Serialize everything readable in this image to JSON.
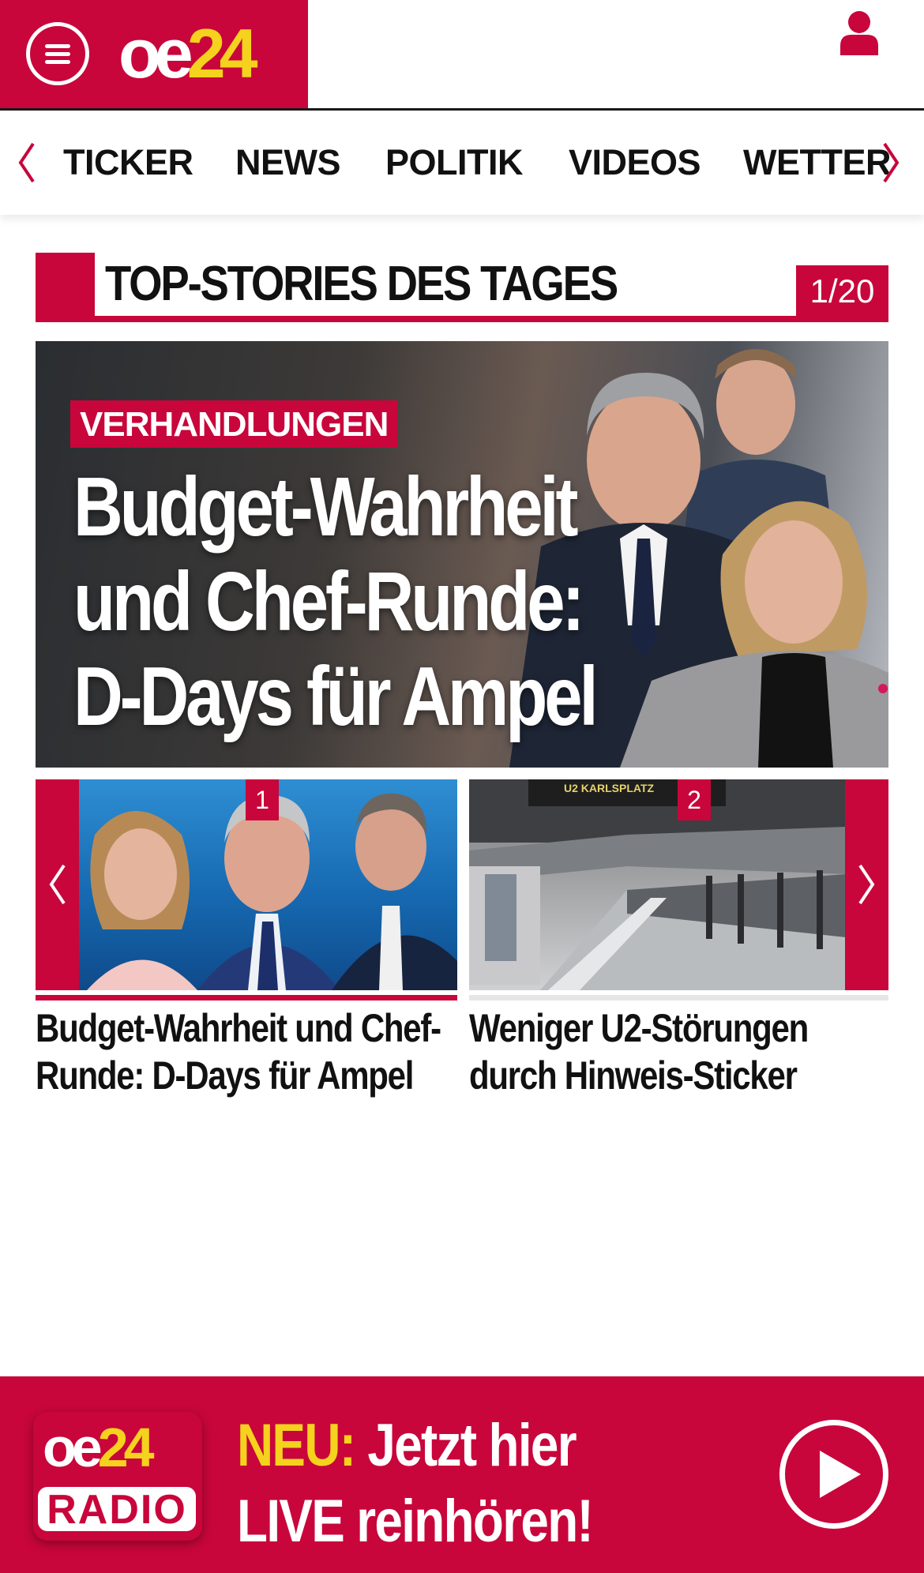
{
  "header": {
    "logo_oe": "oe",
    "logo_num": "24"
  },
  "nav": {
    "items": [
      "TICKER",
      "NEWS",
      "POLITIK",
      "VIDEOS",
      "WETTER"
    ]
  },
  "section": {
    "title": "TOP-STORIES DES TAGES",
    "counter": "1/20"
  },
  "hero": {
    "tag": "VERHANDLUNGEN",
    "headline_lines": [
      "Budget-Wahrheit",
      "und Chef-Runde:",
      "D-Days für Ampel"
    ]
  },
  "cards": [
    {
      "badge": "1",
      "title_lines": [
        "Budget-Wahrheit und Chef-",
        "Runde: D-Days für Ampel"
      ]
    },
    {
      "badge": "2",
      "title_lines": [
        "Weniger U2-Störungen",
        "durch Hinweis-Sticker"
      ],
      "sign_text": "U2 KARLSPLATZ"
    }
  ],
  "radio": {
    "logo_oe": "oe",
    "logo_num": "24",
    "logo_word": "RADIO",
    "neu_label": "NEU:",
    "line1": "Jetzt hier",
    "line2": "LIVE reinhören!"
  },
  "colors": {
    "brand_red": "#c8063b",
    "logo_yellow": "#f4d21d"
  },
  "icons": {
    "menu": "hamburger-icon",
    "user": "user-icon",
    "play": "play-icon",
    "prev": "chevron-left-icon",
    "next": "chevron-right-icon"
  }
}
